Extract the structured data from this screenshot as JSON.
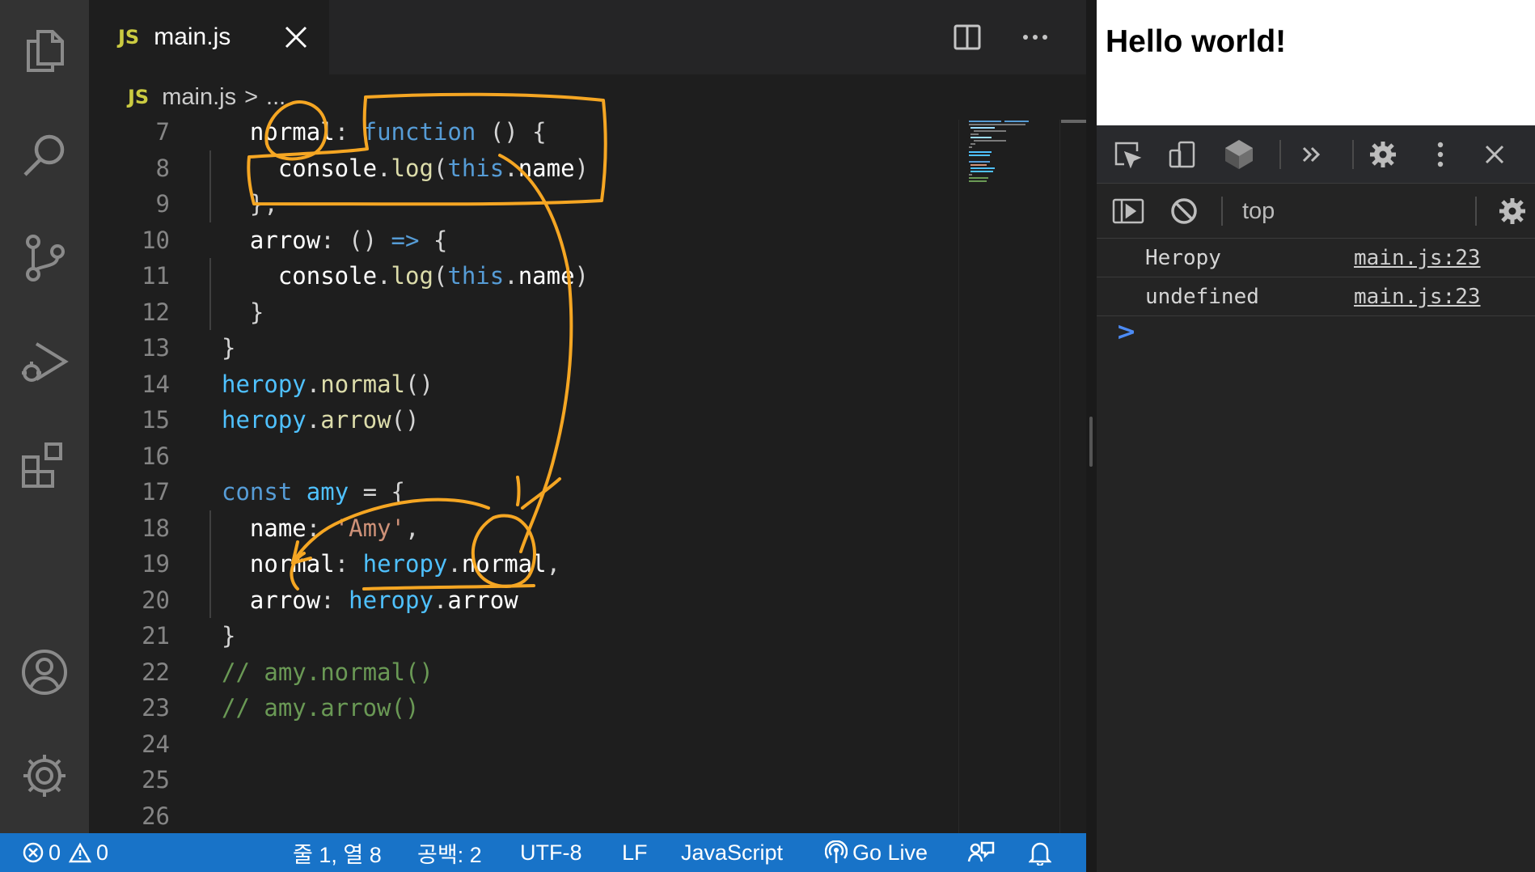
{
  "editor": {
    "tab": {
      "badge": "JS",
      "label": "main.js"
    },
    "breadcrumb": {
      "badge": "JS",
      "file": "main.js",
      "separator": ">",
      "symbol": "..."
    },
    "lines": [
      {
        "n": "7",
        "tokens": [
          [
            "t-pl",
            "  "
          ],
          [
            "t-prop",
            "normal"
          ],
          [
            "t-pl",
            ": "
          ],
          [
            "t-kw",
            "function"
          ],
          [
            "t-pl",
            " () {"
          ]
        ]
      },
      {
        "n": "8",
        "tokens": [
          [
            "t-pl",
            "    "
          ],
          [
            "t-prop",
            "console"
          ],
          [
            "t-pl",
            "."
          ],
          [
            "t-fn",
            "log"
          ],
          [
            "t-pl",
            "("
          ],
          [
            "t-kw",
            "this"
          ],
          [
            "t-pl",
            "."
          ],
          [
            "t-prop",
            "name"
          ],
          [
            "t-pl",
            ")"
          ]
        ]
      },
      {
        "n": "9",
        "tokens": [
          [
            "t-pl",
            "  },"
          ]
        ]
      },
      {
        "n": "10",
        "tokens": [
          [
            "t-pl",
            "  "
          ],
          [
            "t-prop",
            "arrow"
          ],
          [
            "t-pl",
            ": () "
          ],
          [
            "t-kw",
            "=>"
          ],
          [
            "t-pl",
            " {"
          ]
        ]
      },
      {
        "n": "11",
        "tokens": [
          [
            "t-pl",
            "    "
          ],
          [
            "t-prop",
            "console"
          ],
          [
            "t-pl",
            "."
          ],
          [
            "t-fn",
            "log"
          ],
          [
            "t-pl",
            "("
          ],
          [
            "t-kw",
            "this"
          ],
          [
            "t-pl",
            "."
          ],
          [
            "t-prop",
            "name"
          ],
          [
            "t-pl",
            ")"
          ]
        ]
      },
      {
        "n": "12",
        "tokens": [
          [
            "t-pl",
            "  }"
          ]
        ]
      },
      {
        "n": "13",
        "tokens": [
          [
            "t-pl",
            "}"
          ]
        ]
      },
      {
        "n": "14",
        "tokens": [
          [
            "t-obj",
            "heropy"
          ],
          [
            "t-pl",
            "."
          ],
          [
            "t-fn",
            "normal"
          ],
          [
            "t-pl",
            "()"
          ]
        ]
      },
      {
        "n": "15",
        "tokens": [
          [
            "t-obj",
            "heropy"
          ],
          [
            "t-pl",
            "."
          ],
          [
            "t-fn",
            "arrow"
          ],
          [
            "t-pl",
            "()"
          ]
        ]
      },
      {
        "n": "16",
        "tokens": []
      },
      {
        "n": "17",
        "tokens": [
          [
            "t-kw",
            "const"
          ],
          [
            "t-pl",
            " "
          ],
          [
            "t-obj",
            "amy"
          ],
          [
            "t-pl",
            " = {"
          ]
        ]
      },
      {
        "n": "18",
        "tokens": [
          [
            "t-pl",
            "  "
          ],
          [
            "t-prop",
            "name"
          ],
          [
            "t-pl",
            ": "
          ],
          [
            "t-str",
            "'Amy'"
          ],
          [
            "t-pl",
            ","
          ]
        ]
      },
      {
        "n": "19",
        "tokens": [
          [
            "t-pl",
            "  "
          ],
          [
            "t-prop",
            "normal"
          ],
          [
            "t-pl",
            ": "
          ],
          [
            "t-obj",
            "heropy"
          ],
          [
            "t-pl",
            "."
          ],
          [
            "t-prop",
            "normal"
          ],
          [
            "t-pl",
            ","
          ]
        ]
      },
      {
        "n": "20",
        "tokens": [
          [
            "t-pl",
            "  "
          ],
          [
            "t-prop",
            "arrow"
          ],
          [
            "t-pl",
            ": "
          ],
          [
            "t-obj",
            "heropy"
          ],
          [
            "t-pl",
            "."
          ],
          [
            "t-prop",
            "arrow"
          ]
        ]
      },
      {
        "n": "21",
        "tokens": [
          [
            "t-pl",
            "}"
          ]
        ]
      },
      {
        "n": "22",
        "tokens": [
          [
            "t-cm",
            "// amy.normal()"
          ]
        ]
      },
      {
        "n": "23",
        "tokens": [
          [
            "t-cm",
            "// amy.arrow()"
          ]
        ]
      },
      {
        "n": "24",
        "tokens": []
      },
      {
        "n": "25",
        "tokens": []
      },
      {
        "n": "26",
        "tokens": []
      }
    ]
  },
  "status_bar": {
    "errors": "0",
    "warnings": "0",
    "cursor": "줄 1, 열 8",
    "spaces": "공백: 2",
    "encoding": "UTF-8",
    "eol": "LF",
    "language": "JavaScript",
    "go_live": "Go Live"
  },
  "browser": {
    "heading": "Hello world!",
    "context": "top",
    "console": [
      {
        "message": "Heropy",
        "source": "main.js:23"
      },
      {
        "message": "undefined",
        "source": "main.js:23"
      }
    ],
    "prompt": ">"
  },
  "colors": {
    "status_bar": "#1873c8",
    "annotation": "#f5a623",
    "keyword": "#569cd6"
  }
}
